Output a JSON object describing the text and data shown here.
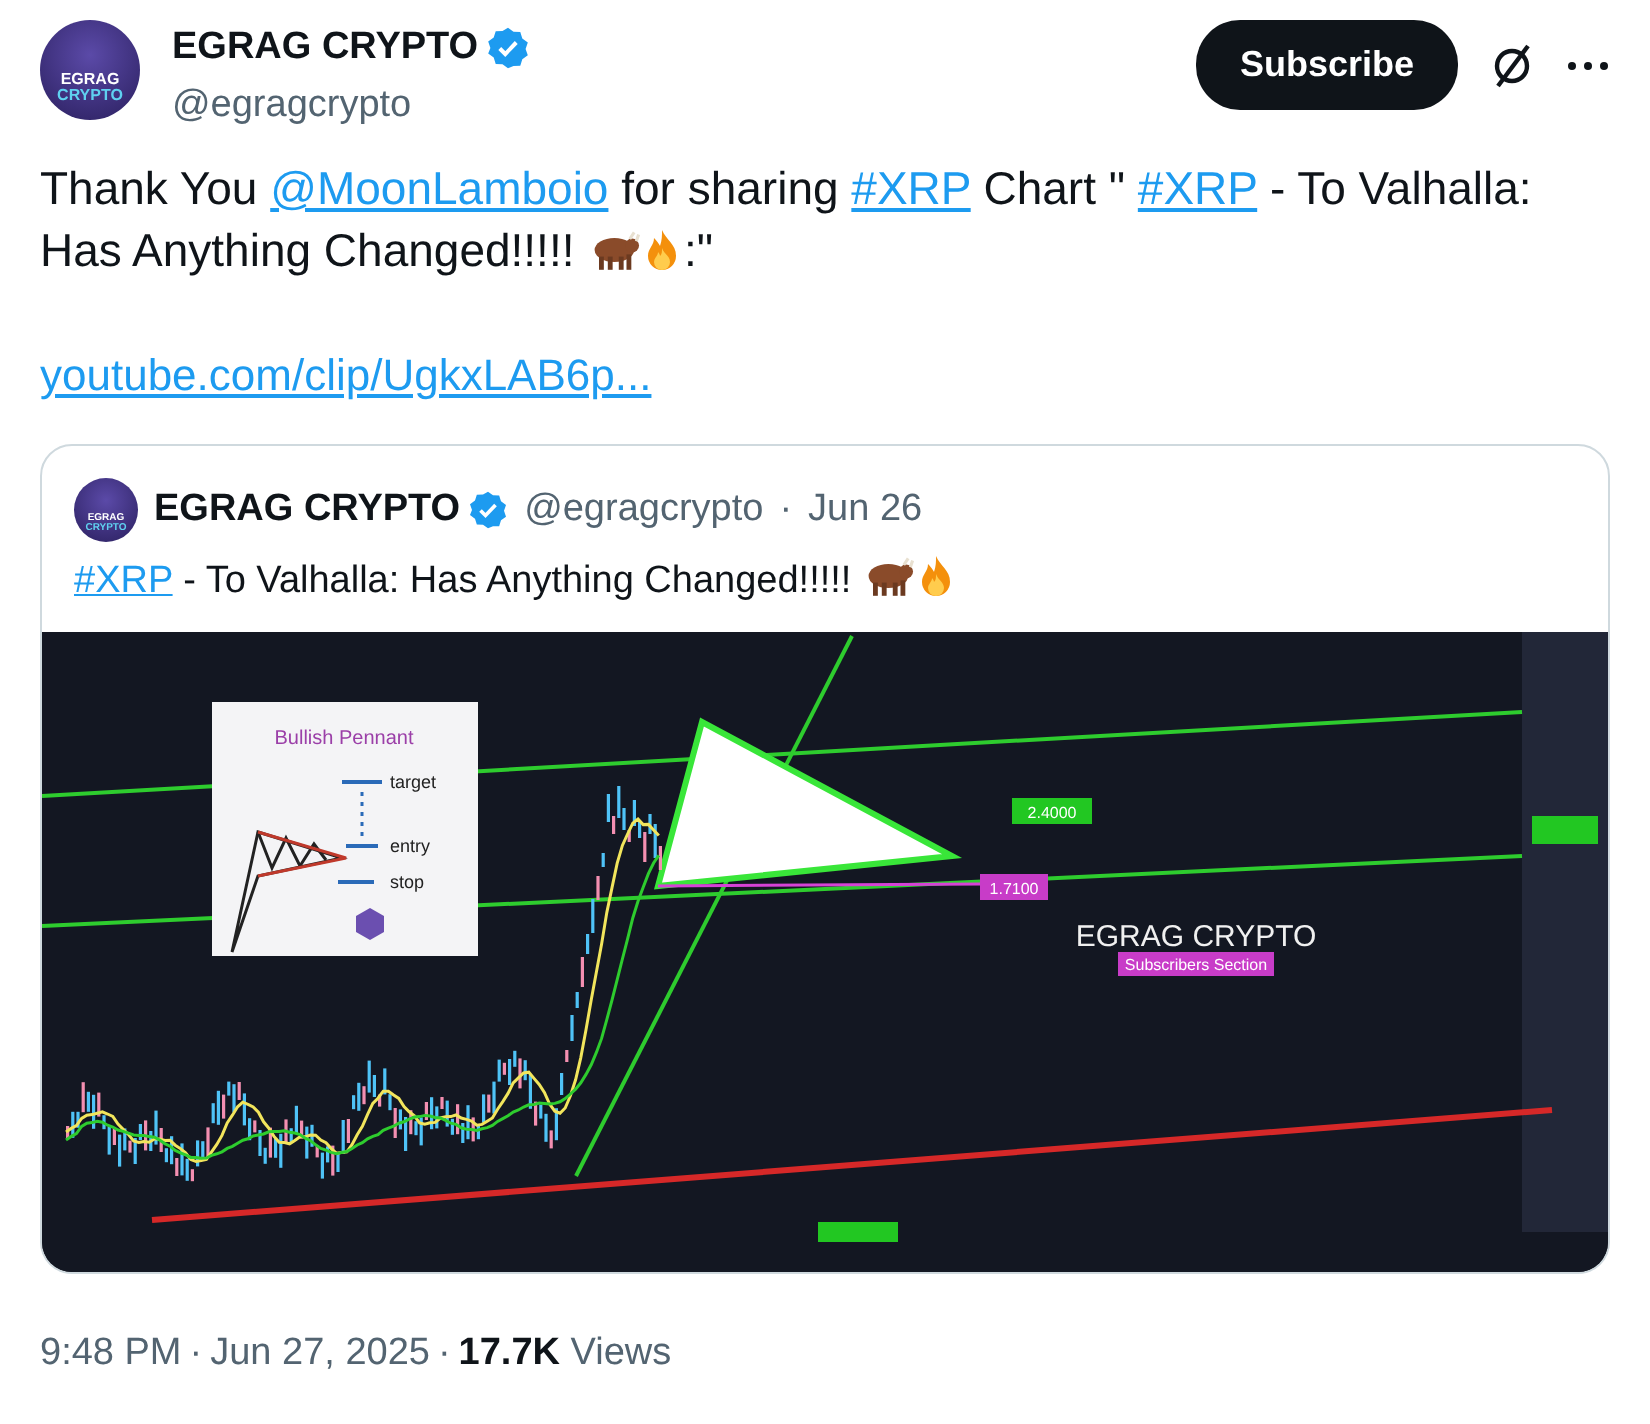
{
  "author": {
    "name": "EGRAG CRYPTO",
    "handle": "@egragcrypto",
    "verified": true,
    "avatar_lines": [
      "EGRAG",
      "CRYPTO"
    ]
  },
  "subscribe_button": "Subscribe",
  "tweet_text": [
    {
      "kind": "text",
      "text": "Thank You "
    },
    {
      "kind": "link",
      "text": "@MoonLamboio"
    },
    {
      "kind": "text",
      "text": " for sharing "
    },
    {
      "kind": "link",
      "text": "#XRP"
    },
    {
      "kind": "text",
      "text": " Chart \" "
    },
    {
      "kind": "link",
      "text": "#XRP"
    },
    {
      "kind": "text",
      "text": " - To Valhalla: Has Anything Changed!!!!! "
    },
    {
      "kind": "ox"
    },
    {
      "kind": "fire"
    },
    {
      "kind": "text",
      "text": ":\""
    }
  ],
  "url": "youtube.com/clip/UgkxLAB6p...",
  "quote": {
    "avatar_lines": [
      "EGRAG",
      "CRYPTO"
    ],
    "name": "EGRAG CRYPTO",
    "handle": "@egragcrypto",
    "verified": true,
    "date": "Jun 26",
    "separator": "·",
    "text": [
      {
        "kind": "link",
        "text": "#XRP"
      },
      {
        "kind": "text",
        "text": " - To Valhalla: Has Anything Changed!!!!! "
      },
      {
        "kind": "ox"
      },
      {
        "kind": "fire"
      }
    ],
    "chart_image": {
      "inset_title": "Bullish Pennant",
      "inset_labels": [
        "target",
        "entry",
        "stop"
      ],
      "upper_level": "2.4000",
      "lower_level": "1.7100",
      "brand": "EGRAG CRYPTO",
      "section": "Subscribers Section"
    }
  },
  "footer": {
    "time": "9:48 PM",
    "date": "Jun 27, 2025",
    "views_count": "17.7K",
    "views_label": "Views",
    "separator": "·"
  }
}
